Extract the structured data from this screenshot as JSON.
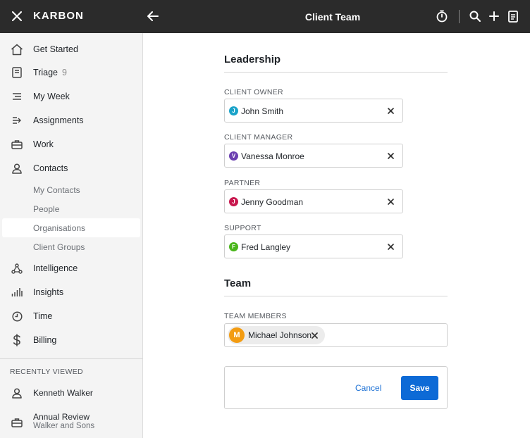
{
  "topbar": {
    "brand": "KARBON",
    "title": "Client Team"
  },
  "sidebar": {
    "items": [
      {
        "label": "Get Started",
        "icon": "home-icon"
      },
      {
        "label": "Triage",
        "count": "9",
        "icon": "triage-icon"
      },
      {
        "label": "My Week",
        "icon": "list-icon"
      },
      {
        "label": "Assignments",
        "icon": "assign-icon"
      },
      {
        "label": "Work",
        "icon": "briefcase-icon"
      },
      {
        "label": "Contacts",
        "icon": "person-icon"
      },
      {
        "label": "Intelligence",
        "icon": "network-icon"
      },
      {
        "label": "Insights",
        "icon": "bars-icon"
      },
      {
        "label": "Time",
        "icon": "clock-icon"
      },
      {
        "label": "Billing",
        "icon": "dollar-icon"
      }
    ],
    "contacts_sub": [
      "My Contacts",
      "People",
      "Organisations",
      "Client Groups"
    ],
    "active_sub": "Organisations",
    "recent_header": "RECENTLY VIEWED",
    "recent": [
      {
        "line1": "Kenneth Walker",
        "line2": ""
      },
      {
        "line1": "Annual Review",
        "line2": "Walker and Sons"
      }
    ]
  },
  "main": {
    "leadership_title": "Leadership",
    "fields": [
      {
        "label": "CLIENT OWNER",
        "initial": "J",
        "name": "John Smith",
        "color": "#1aa3c9"
      },
      {
        "label": "CLIENT MANAGER",
        "initial": "V",
        "name": "Vanessa Monroe",
        "color": "#6b3fb0"
      },
      {
        "label": "PARTNER",
        "initial": "J",
        "name": "Jenny Goodman",
        "color": "#c8174e"
      },
      {
        "label": "SUPPORT",
        "initial": "F",
        "name": "Fred Langley",
        "color": "#49b51a"
      }
    ],
    "team_title": "Team",
    "team_label": "TEAM MEMBERS",
    "team_members": [
      {
        "initial": "M",
        "name": "Michael Johnson",
        "color": "#f39c12"
      }
    ],
    "cancel_label": "Cancel",
    "save_label": "Save"
  },
  "colors": {
    "topbar": "#2b2b2b",
    "primary": "#0d6ad6",
    "sidebar_bg": "#f4f4f4"
  }
}
